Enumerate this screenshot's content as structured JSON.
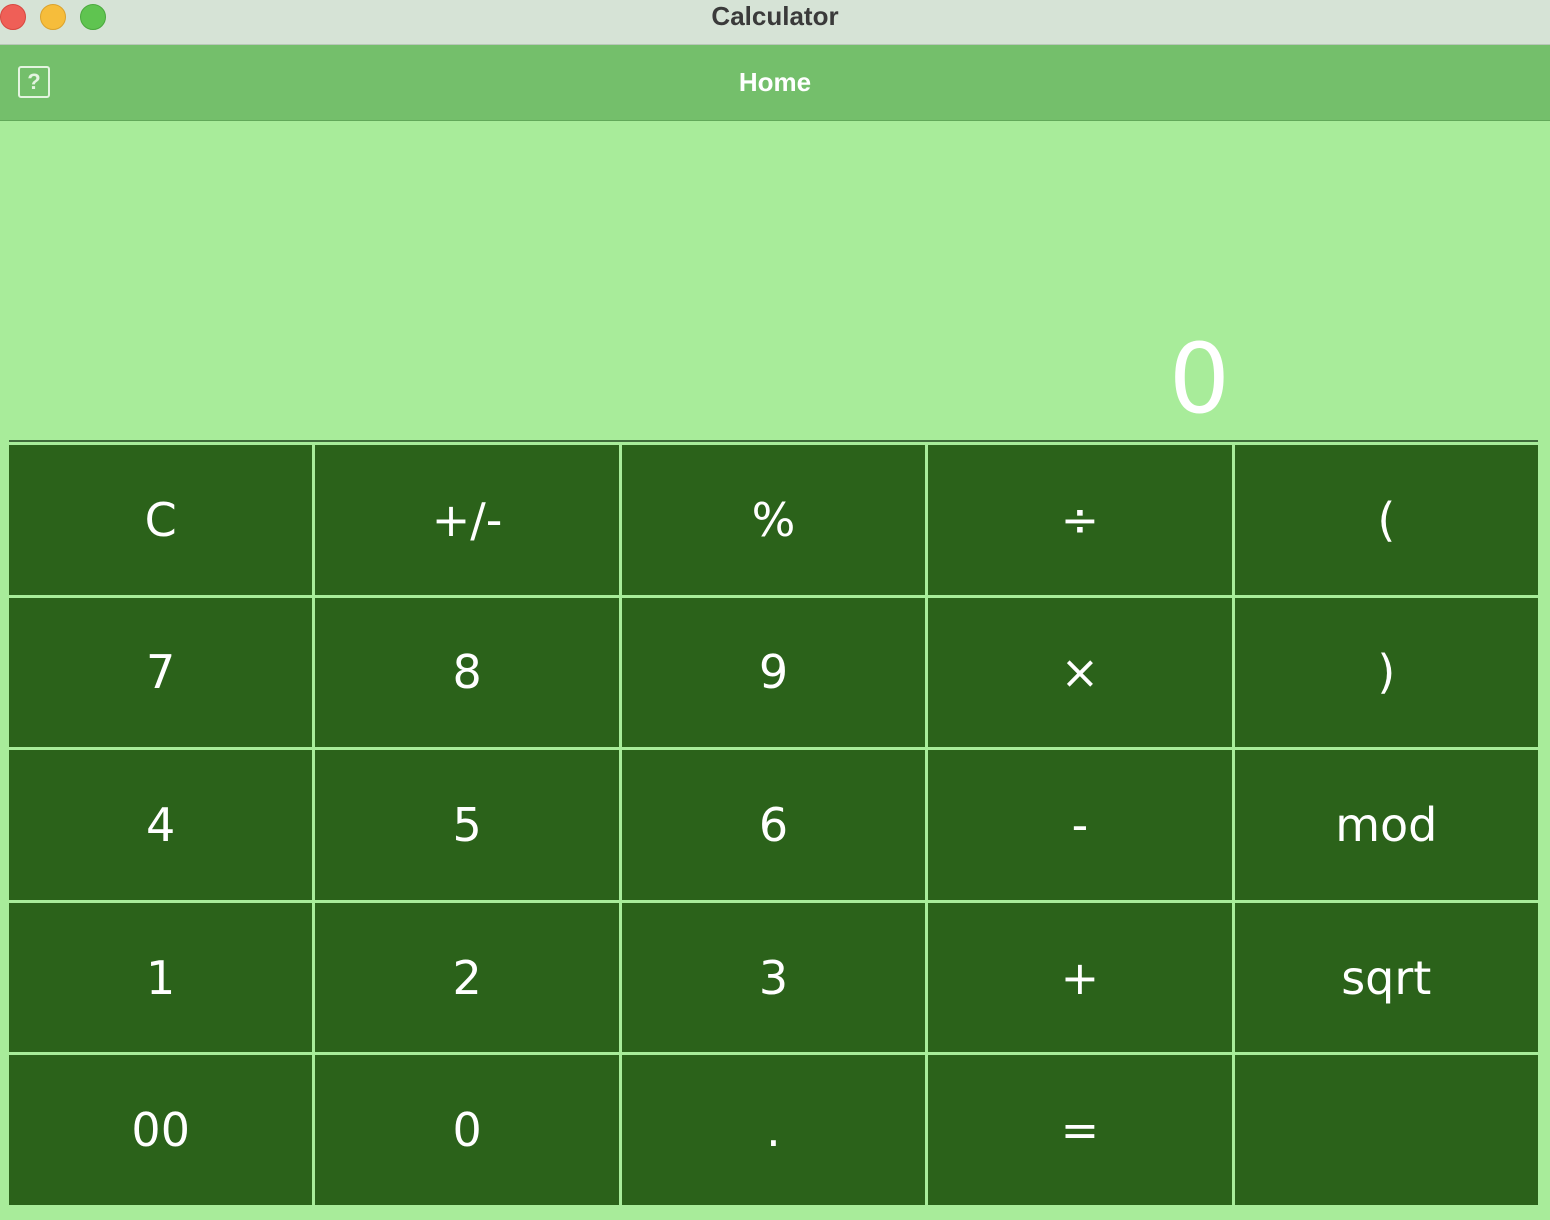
{
  "window": {
    "title": "Calculator"
  },
  "header": {
    "title": "Home",
    "help_label": "?"
  },
  "display": {
    "value": "0"
  },
  "keypad": {
    "rows": [
      [
        "C",
        "+/-",
        "%",
        "÷",
        "("
      ],
      [
        "7",
        "8",
        "9",
        "×",
        ")"
      ],
      [
        "4",
        "5",
        "6",
        "-",
        "mod"
      ],
      [
        "1",
        "2",
        "3",
        "+",
        "sqrt"
      ],
      [
        "00",
        "0",
        ".",
        "=",
        ""
      ]
    ]
  },
  "colors": {
    "background": "#a8ec9a",
    "header": "#74bf6b",
    "key": "#2b621a",
    "text": "#ffffff"
  }
}
